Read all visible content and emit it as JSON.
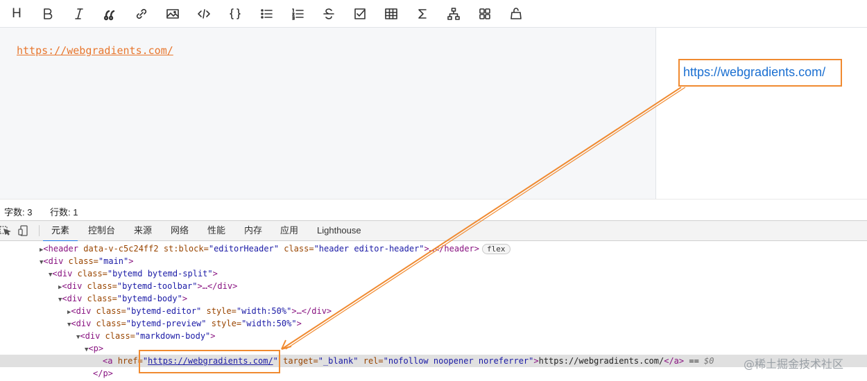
{
  "toolbar": {
    "heading_label": "H",
    "items": [
      "heading",
      "bold",
      "italic",
      "quote",
      "link",
      "image",
      "code",
      "code-block",
      "unordered-list",
      "ordered-list",
      "strikethrough",
      "task-list",
      "table",
      "math",
      "diagram",
      "gallery",
      "frontmatter"
    ]
  },
  "editor": {
    "content": "https://webgradients.com/"
  },
  "preview": {
    "link_text": "https://webgradients.com/"
  },
  "status": {
    "words": "字数: 3",
    "lines": "行数: 1"
  },
  "devtools": {
    "tabs": [
      "元素",
      "控制台",
      "来源",
      "网络",
      "性能",
      "内存",
      "应用",
      "Lighthouse"
    ],
    "active_tab": "元素",
    "dom": {
      "r1_tag_open": "<header ",
      "r1_attrs": "data-v-c5c24ff2 st:block=",
      "r1_val1": "\"editorHeader\"",
      "r1_attr2": " class=",
      "r1_val2": "\"header editor-header\"",
      "r1_tail": ">…</header>",
      "r1_badge": "flex",
      "r2_open": "<div ",
      "r2_attr": "class=",
      "r2_val": "\"main\"",
      "r2_close": ">",
      "r3_val": "\"bytemd bytemd-split\"",
      "r4_val": "\"bytemd-toolbar\"",
      "r4_tail": ">…</div>",
      "r5_val": "\"bytemd-body\"",
      "r6_val": "\"bytemd-editor\"",
      "r6_attr2": " style=",
      "r6_val2": "\"width:50%\"",
      "r6_tail": ">…</div>",
      "r7_val": "\"bytemd-preview\"",
      "r7_val2": "\"width:50%\"",
      "r8_val": "\"markdown-body\"",
      "r9_tag": "<p>",
      "r10_a_open": "<a ",
      "r10_href_attr": "href=",
      "r10_href_q1": "\"",
      "r10_href_val": "https://webgradients.com/",
      "r10_href_q2": "\"",
      "r10_target_attr": " target=",
      "r10_target_val": "\"_blank\"",
      "r10_rel_attr": " rel=",
      "r10_rel_val": "\"nofollow noopener noreferrer\"",
      "r10_gt": ">",
      "r10_text": "https://webgradients.com/",
      "r10_close": "</a>",
      "r10_eq": " == ",
      "r10_dollar": "$0",
      "r11_tag": "</p>"
    }
  },
  "watermark": "@稀土掘金技术社区",
  "colors": {
    "annotation": "#f08a30",
    "link": "#1a6fd1",
    "editor_link": "#e8772e"
  }
}
